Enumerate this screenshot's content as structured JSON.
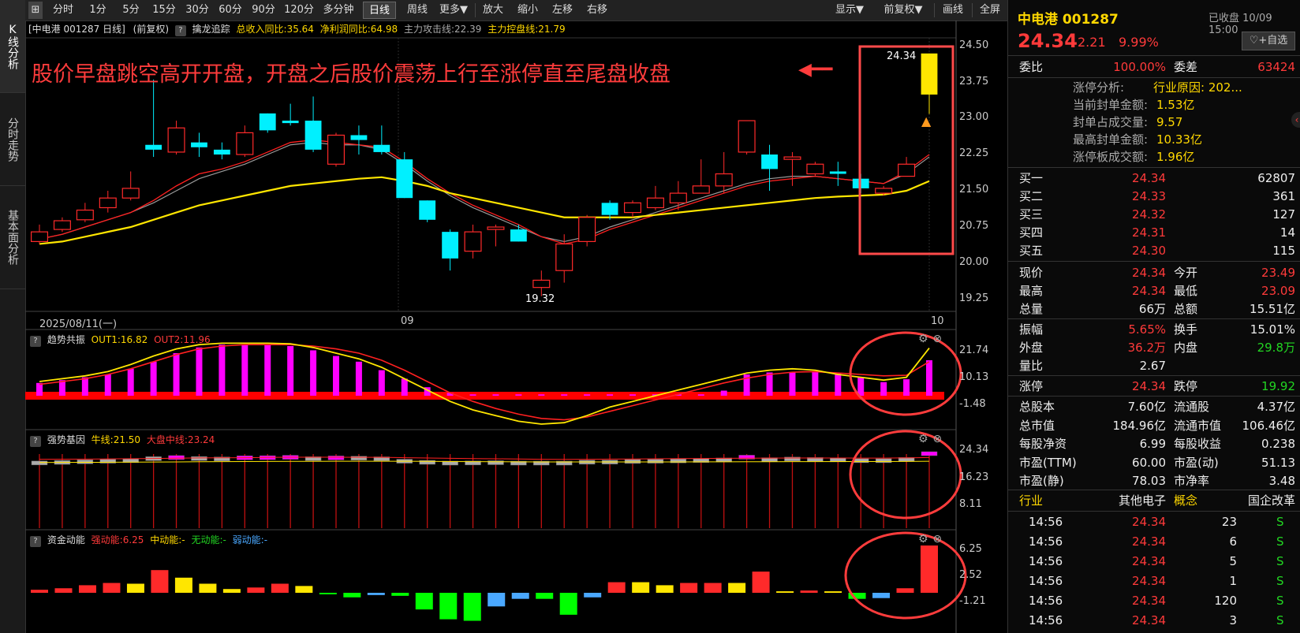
{
  "toolbar": {
    "icon_label": "⊞",
    "items": [
      "分时",
      "1分",
      "5分",
      "15分",
      "30分",
      "60分",
      "90分",
      "120分",
      "多分钟",
      "日线",
      "周线",
      "更多▼",
      "放大",
      "缩小",
      "左移",
      "右移"
    ],
    "active_index": 9,
    "right_items": [
      "显示▼",
      "前复权▼",
      "画线",
      "全屏"
    ]
  },
  "left_tabs": [
    "K线分析",
    "分时走势",
    "基本面分析"
  ],
  "info": {
    "security": "[中电港 001287 日线]",
    "adjust": "(前复权)",
    "indicator": "擒龙追踪",
    "revenue": "总收入同比:35.64",
    "profit": "净利润同比:64.98",
    "attack": "主力攻击线:22.39",
    "control": "主力控盘线:21.79"
  },
  "annotation": "股价早盘跳空高开开盘，开盘之后股价震荡上行至涨停直至尾盘收盘",
  "annotation_arrow": "◀━━",
  "main_axis": [
    "24.50",
    "23.75",
    "23.00",
    "22.25",
    "21.50",
    "20.75",
    "20.00",
    "19.25"
  ],
  "date_axis": {
    "start": "2025/08/11(一)",
    "mid": "09",
    "end": "10"
  },
  "low_marker": "19.32",
  "high_marker": "24.34",
  "panel1": {
    "title": "趋势共振",
    "out1": "OUT1:16.82",
    "out2": "OUT2:11.96",
    "axis": [
      "21.74",
      "10.13",
      "-1.48"
    ]
  },
  "panel2": {
    "title": "强势基因",
    "cow": "牛线:21.50",
    "market": "大盘中线:23.24",
    "axis": [
      "24.34",
      "16.23",
      "8.11"
    ]
  },
  "panel3": {
    "title": "资金动能",
    "strong": "强动能:6.25",
    "mid": "中动能:-",
    "none": "无动能:-",
    "weak": "弱动能:-",
    "axis": [
      "6.25",
      "2.52",
      "-1.21"
    ]
  },
  "chart_data": {
    "type": "candlestick",
    "candles": [
      {
        "o": 20.45,
        "c": 20.65,
        "h": 20.8,
        "l": 20.4
      },
      {
        "o": 20.7,
        "c": 20.88,
        "h": 20.95,
        "l": 20.65
      },
      {
        "o": 20.9,
        "c": 21.1,
        "h": 21.25,
        "l": 20.85
      },
      {
        "o": 21.15,
        "c": 21.35,
        "h": 21.5,
        "l": 21.05
      },
      {
        "o": 21.35,
        "c": 21.55,
        "h": 21.9,
        "l": 21.3
      },
      {
        "o": 22.45,
        "c": 22.35,
        "h": 23.8,
        "l": 22.2
      },
      {
        "o": 22.3,
        "c": 22.8,
        "h": 22.95,
        "l": 22.25
      },
      {
        "o": 22.5,
        "c": 22.4,
        "h": 22.7,
        "l": 22.2
      },
      {
        "o": 22.35,
        "c": 22.25,
        "h": 22.5,
        "l": 22.15
      },
      {
        "o": 22.25,
        "c": 22.7,
        "h": 22.85,
        "l": 22.2
      },
      {
        "o": 23.1,
        "c": 22.75,
        "h": 23.1,
        "l": 22.7
      },
      {
        "o": 22.95,
        "c": 22.9,
        "h": 23.3,
        "l": 22.85
      },
      {
        "o": 22.95,
        "c": 22.35,
        "h": 23.45,
        "l": 22.3
      },
      {
        "o": 22.05,
        "c": 22.65,
        "h": 22.7,
        "l": 22.0
      },
      {
        "o": 22.65,
        "c": 22.55,
        "h": 22.85,
        "l": 22.25
      },
      {
        "o": 22.45,
        "c": 22.3,
        "h": 22.85,
        "l": 22.25
      },
      {
        "o": 22.15,
        "c": 21.35,
        "h": 22.3,
        "l": 21.35
      },
      {
        "o": 21.3,
        "c": 20.9,
        "h": 21.3,
        "l": 20.85
      },
      {
        "o": 20.65,
        "c": 20.1,
        "h": 20.7,
        "l": 19.85
      },
      {
        "o": 20.25,
        "c": 20.65,
        "h": 20.8,
        "l": 20.1
      },
      {
        "o": 20.7,
        "c": 20.75,
        "h": 20.8,
        "l": 20.35
      },
      {
        "o": 20.7,
        "c": 20.45,
        "h": 20.8,
        "l": 20.45
      },
      {
        "o": 19.5,
        "c": 19.65,
        "h": 19.85,
        "l": 19.32
      },
      {
        "o": 19.85,
        "c": 20.4,
        "h": 20.6,
        "l": 19.6
      },
      {
        "o": 20.45,
        "c": 20.95,
        "h": 21.0,
        "l": 20.35
      },
      {
        "o": 21.25,
        "c": 21.0,
        "h": 21.3,
        "l": 20.9
      },
      {
        "o": 21.05,
        "c": 21.25,
        "h": 21.3,
        "l": 20.95
      },
      {
        "o": 21.15,
        "c": 21.35,
        "h": 21.6,
        "l": 21.1
      },
      {
        "o": 21.25,
        "c": 21.45,
        "h": 21.7,
        "l": 21.1
      },
      {
        "o": 21.45,
        "c": 21.6,
        "h": 22.15,
        "l": 21.45
      },
      {
        "o": 21.6,
        "c": 21.85,
        "h": 22.3,
        "l": 21.45
      },
      {
        "o": 22.3,
        "c": 22.95,
        "h": 22.95,
        "l": 22.25
      },
      {
        "o": 22.25,
        "c": 21.95,
        "h": 22.45,
        "l": 21.5
      },
      {
        "o": 22.15,
        "c": 22.2,
        "h": 22.3,
        "l": 21.6
      },
      {
        "o": 21.85,
        "c": 22.05,
        "h": 22.1,
        "l": 21.8
      },
      {
        "o": 21.9,
        "c": 21.85,
        "h": 22.1,
        "l": 21.6
      },
      {
        "o": 21.75,
        "c": 21.55,
        "h": 21.85,
        "l": 21.45
      },
      {
        "o": 21.45,
        "c": 21.55,
        "h": 21.6,
        "l": 21.4
      },
      {
        "o": 21.8,
        "c": 22.05,
        "h": 22.2,
        "l": 21.8
      },
      {
        "o": 23.49,
        "c": 24.34,
        "h": 24.34,
        "l": 23.09
      }
    ],
    "ma_red": [
      20.5,
      20.6,
      20.75,
      20.9,
      21.05,
      21.3,
      21.6,
      21.85,
      21.95,
      22.1,
      22.3,
      22.5,
      22.55,
      22.5,
      22.45,
      22.4,
      22.1,
      21.75,
      21.45,
      21.2,
      21.0,
      20.8,
      20.55,
      20.4,
      20.5,
      20.7,
      20.85,
      21.0,
      21.15,
      21.3,
      21.45,
      21.6,
      21.7,
      21.75,
      21.8,
      21.75,
      21.7,
      21.65,
      21.9,
      22.25
    ],
    "ma_gray": [
      20.5,
      20.6,
      20.75,
      20.9,
      21.05,
      21.25,
      21.5,
      21.75,
      21.9,
      22.05,
      22.25,
      22.45,
      22.5,
      22.45,
      22.45,
      22.35,
      22.05,
      21.7,
      21.4,
      21.15,
      20.95,
      20.75,
      20.55,
      20.45,
      20.55,
      20.75,
      20.9,
      21.05,
      21.2,
      21.35,
      21.5,
      21.65,
      21.75,
      21.8,
      21.8,
      21.75,
      21.7,
      21.65,
      21.85,
      22.2
    ],
    "ma_yellow": [
      20.4,
      20.45,
      20.55,
      20.65,
      20.75,
      20.9,
      21.05,
      21.2,
      21.3,
      21.4,
      21.5,
      21.6,
      21.65,
      21.7,
      21.75,
      21.78,
      21.7,
      21.6,
      21.45,
      21.35,
      21.25,
      21.15,
      21.05,
      20.95,
      20.95,
      20.95,
      20.95,
      21.0,
      21.05,
      21.1,
      21.15,
      21.2,
      21.25,
      21.3,
      21.35,
      21.38,
      21.4,
      21.42,
      21.5,
      21.7
    ],
    "panel1_bars": [
      4.5,
      5.5,
      6.5,
      7.5,
      9.5,
      12,
      15,
      17,
      18,
      18,
      18,
      17.5,
      16,
      14,
      12,
      9,
      6,
      3,
      1,
      0.5,
      0.5,
      0.5,
      0.5,
      0.5,
      0.5,
      0.5,
      0.5,
      0.5,
      0.5,
      0.5,
      1.8,
      7.5,
      8.2,
      8.3,
      8.5,
      7.8,
      6.5,
      4.8,
      5.8,
      12.5
    ],
    "panel1_out1": [
      5,
      6,
      7,
      8.5,
      11,
      14,
      16.5,
      18,
      18.5,
      18.5,
      18.5,
      18.3,
      17,
      15,
      13,
      10,
      6,
      2,
      -2,
      -5,
      -7,
      -9,
      -10,
      -9.5,
      -7,
      -4,
      -2,
      0,
      2,
      4,
      6,
      8,
      9,
      9.5,
      9,
      7.5,
      6.5,
      5.5,
      6.5,
      16.8
    ],
    "panel1_out2": [
      4,
      5,
      6,
      7.5,
      9.5,
      12,
      14.5,
      16.5,
      17.5,
      18,
      18,
      18,
      17.5,
      16.5,
      15,
      12.5,
      9,
      5,
      1,
      -2,
      -4.5,
      -6.5,
      -8,
      -8.5,
      -7.5,
      -5.5,
      -3.5,
      -1.5,
      0.5,
      2.5,
      4.5,
      6.2,
      7.5,
      8.3,
      8.5,
      8,
      7.5,
      7,
      7.2,
      12
    ],
    "panel3_bars": [
      {
        "v": 0.4,
        "c": "red"
      },
      {
        "v": 0.6,
        "c": "red"
      },
      {
        "v": 1.0,
        "c": "red"
      },
      {
        "v": 1.3,
        "c": "red"
      },
      {
        "v": 1.2,
        "c": "yellow"
      },
      {
        "v": 3.0,
        "c": "red"
      },
      {
        "v": 2.0,
        "c": "yellow"
      },
      {
        "v": 1.2,
        "c": "yellow"
      },
      {
        "v": 0.5,
        "c": "yellow"
      },
      {
        "v": 0.7,
        "c": "red"
      },
      {
        "v": 1.2,
        "c": "red"
      },
      {
        "v": 0.9,
        "c": "yellow"
      },
      {
        "v": -0.2,
        "c": "green"
      },
      {
        "v": -0.6,
        "c": "green"
      },
      {
        "v": -0.3,
        "c": "blue"
      },
      {
        "v": -0.4,
        "c": "green"
      },
      {
        "v": -2.2,
        "c": "green"
      },
      {
        "v": -3.5,
        "c": "green"
      },
      {
        "v": -3.7,
        "c": "green"
      },
      {
        "v": -1.8,
        "c": "blue"
      },
      {
        "v": -0.8,
        "c": "blue"
      },
      {
        "v": -0.8,
        "c": "green"
      },
      {
        "v": -2.9,
        "c": "green"
      },
      {
        "v": -0.6,
        "c": "blue"
      },
      {
        "v": 1.4,
        "c": "red"
      },
      {
        "v": 1.4,
        "c": "yellow"
      },
      {
        "v": 1.0,
        "c": "yellow"
      },
      {
        "v": 1.3,
        "c": "red"
      },
      {
        "v": 1.3,
        "c": "red"
      },
      {
        "v": 1.3,
        "c": "yellow"
      },
      {
        "v": 2.8,
        "c": "red"
      },
      {
        "v": 0.2,
        "c": "yellow"
      },
      {
        "v": 0.3,
        "c": "red"
      },
      {
        "v": 0.2,
        "c": "yellow"
      },
      {
        "v": -0.8,
        "c": "green"
      },
      {
        "v": -0.7,
        "c": "blue"
      },
      {
        "v": 0.6,
        "c": "red"
      },
      {
        "v": 6.25,
        "c": "red"
      }
    ]
  },
  "right": {
    "name": "中电港 001287",
    "status": "已收盘 10/09 15:00",
    "price": "24.34",
    "change": "2.21",
    "change_pct": "9.99%",
    "fav": "♡+自选",
    "weibi_label": "委比",
    "weibi": "100.00%",
    "weicha_label": "委差",
    "weicha": "63424",
    "limit_info": [
      {
        "k": "涨停分析:",
        "v": "行业原因: 202..."
      },
      {
        "k": "当前封单金额:",
        "v": "1.53亿"
      },
      {
        "k": "封单占成交量:",
        "v": "9.57"
      },
      {
        "k": "最高封单金额:",
        "v": "10.33亿"
      },
      {
        "k": "涨停板成交额:",
        "v": "1.96亿"
      }
    ],
    "bids": [
      {
        "k": "买一",
        "p": "24.34",
        "v": "62807"
      },
      {
        "k": "买二",
        "p": "24.33",
        "v": "361"
      },
      {
        "k": "买三",
        "p": "24.32",
        "v": "127"
      },
      {
        "k": "买四",
        "p": "24.31",
        "v": "14"
      },
      {
        "k": "买五",
        "p": "24.30",
        "v": "115"
      }
    ],
    "quote": [
      {
        "k1": "现价",
        "v1": "24.34",
        "c1": "red",
        "k2": "今开",
        "v2": "23.49",
        "c2": "red"
      },
      {
        "k1": "最高",
        "v1": "24.34",
        "c1": "red",
        "k2": "最低",
        "v2": "23.09",
        "c2": "red"
      },
      {
        "k1": "总量",
        "v1": "66万",
        "c1": "white",
        "k2": "总额",
        "v2": "15.51亿",
        "c2": "white"
      }
    ],
    "stats": [
      {
        "k1": "振幅",
        "v1": "5.65%",
        "c1": "red",
        "k2": "换手",
        "v2": "15.01%",
        "c2": "white"
      },
      {
        "k1": "外盘",
        "v1": "36.2万",
        "c1": "red",
        "k2": "内盘",
        "v2": "29.8万",
        "c2": "green"
      },
      {
        "k1": "量比",
        "v1": "2.67",
        "c1": "white",
        "k2": "",
        "v2": "",
        "c2": "white"
      }
    ],
    "limits": {
      "k1": "涨停",
      "v1": "24.34",
      "k2": "跌停",
      "v2": "19.92"
    },
    "fund": [
      {
        "k1": "总股本",
        "v1": "7.60亿",
        "k2": "流通股",
        "v2": "4.37亿"
      },
      {
        "k1": "总市值",
        "v1": "184.96亿",
        "k2": "流通市值",
        "v2": "106.46亿"
      },
      {
        "k1": "每股净资",
        "v1": "6.99",
        "k2": "每股收益",
        "v2": "0.238"
      },
      {
        "k1": "市盈(TTM)",
        "v1": "60.00",
        "k2": "市盈(动)",
        "v2": "51.13"
      },
      {
        "k1": "市盈(静)",
        "v1": "78.03",
        "k2": "市净率",
        "v2": "3.48"
      }
    ],
    "industry": {
      "k1": "行业",
      "v1": "其他电子",
      "k2": "概念",
      "v2": "国企改革"
    },
    "ticks": [
      {
        "t": "14:56",
        "p": "24.34",
        "v": "23",
        "s": "S"
      },
      {
        "t": "14:56",
        "p": "24.34",
        "v": "6",
        "s": "S"
      },
      {
        "t": "14:56",
        "p": "24.34",
        "v": "5",
        "s": "S"
      },
      {
        "t": "14:56",
        "p": "24.34",
        "v": "1",
        "s": "S"
      },
      {
        "t": "14:56",
        "p": "24.34",
        "v": "120",
        "s": "S"
      },
      {
        "t": "14:56",
        "p": "24.34",
        "v": "3",
        "s": "S"
      }
    ]
  },
  "colors": {
    "up": "#ff2a2a",
    "down": "#00f0ff",
    "yellow": "#ffe600",
    "magenta": "#ff00ff",
    "green": "#00ff00",
    "blue": "#4aa8ff",
    "annot": "#ff3c3c"
  }
}
